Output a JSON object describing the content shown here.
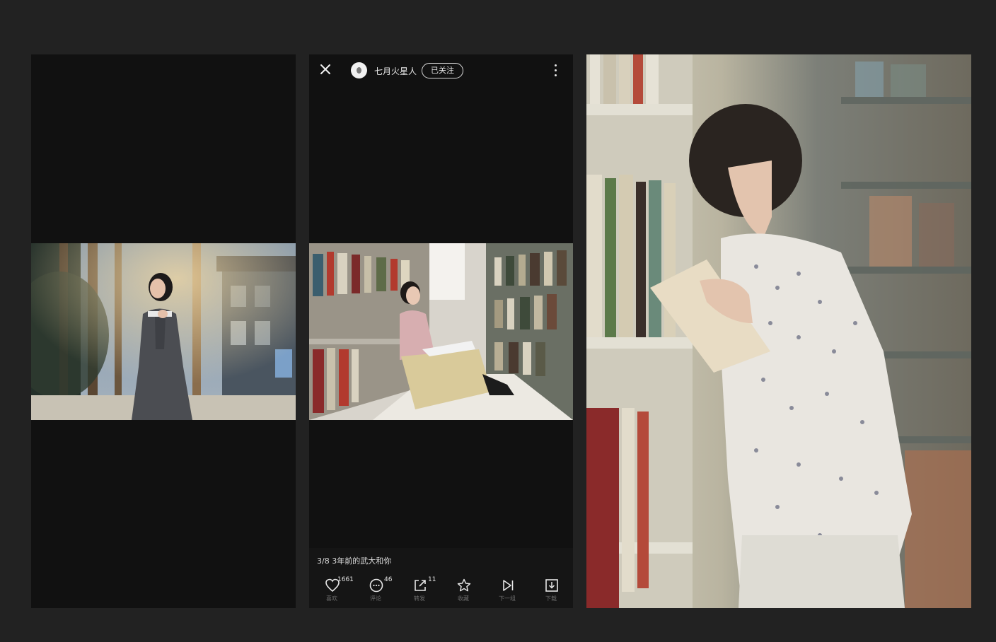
{
  "viewer": {
    "username": "七月火星人",
    "follow_label": "已关注",
    "caption": "3/8 3年前的武大和你",
    "actions": [
      {
        "icon": "heart-icon",
        "count": "1661",
        "label": "喜欢"
      },
      {
        "icon": "comment-icon",
        "count": "46",
        "label": "评论"
      },
      {
        "icon": "share-icon",
        "count": "11",
        "label": "转发"
      },
      {
        "icon": "star-icon",
        "count": "",
        "label": "收藏"
      },
      {
        "icon": "next-icon",
        "count": "",
        "label": "下一组"
      },
      {
        "icon": "download-icon",
        "count": "",
        "label": "下载"
      }
    ]
  },
  "colors": {
    "page_background": "#222222",
    "panel_background": "#111111",
    "text_primary": "#e6e6e6",
    "text_muted": "#6e6e6e"
  }
}
